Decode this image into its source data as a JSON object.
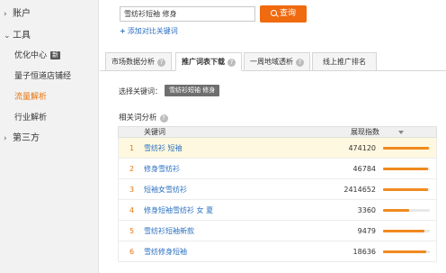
{
  "sidebar": {
    "sections": [
      {
        "label": "账户",
        "chevron": "›",
        "expanded": false
      },
      {
        "label": "工具",
        "chevron": "⌄",
        "expanded": true
      },
      {
        "label": "第三方",
        "chevron": "›",
        "expanded": false
      }
    ],
    "tool_items": [
      {
        "label": "优化中心",
        "badge": "新",
        "active": false
      },
      {
        "label": "量子恒道店铺经",
        "active": false
      },
      {
        "label": "流量解析",
        "active": true
      },
      {
        "label": "行业解析",
        "active": false
      }
    ]
  },
  "search": {
    "value": "雪纺衫短袖 修身",
    "button_label": "查询",
    "add_compare_label": "添加对比关键词"
  },
  "tabs": [
    {
      "label": "市场数据分析",
      "active": false
    },
    {
      "label": "推广词表下载",
      "active": true
    },
    {
      "label": "一周地域透析",
      "active": false
    },
    {
      "label": "线上推广排名",
      "active": false
    }
  ],
  "selected": {
    "label": "选择关键词：",
    "keyword": "雪纺衫短袖 修身"
  },
  "related": {
    "title": "相关词分析",
    "columns": {
      "keyword": "关键词",
      "value": "展现指数"
    },
    "rows": [
      {
        "rank": "1",
        "keyword": "雪纺衫 短袖",
        "value": "474120",
        "bar": 0.98,
        "highlight": true
      },
      {
        "rank": "2",
        "keyword": "修身雪纺衫",
        "value": "46784",
        "bar": 0.96,
        "highlight": false
      },
      {
        "rank": "3",
        "keyword": "短袖女雪纺衫",
        "value": "2414652",
        "bar": 0.97,
        "highlight": false
      },
      {
        "rank": "4",
        "keyword": "修身短袖雪纺衫 女 夏",
        "value": "3360",
        "bar": 0.55,
        "highlight": false
      },
      {
        "rank": "5",
        "keyword": "雪纺衫短袖新款",
        "value": "9479",
        "bar": 0.88,
        "highlight": false
      },
      {
        "rank": "6",
        "keyword": "雪纺修身短袖",
        "value": "18636",
        "bar": 0.92,
        "highlight": false
      }
    ]
  },
  "colors": {
    "accent": "#f06a0f",
    "link": "#2a6fc0",
    "active_nav": "#e8740c",
    "bar": "#f08a1e",
    "highlight_row": "#fdf8df"
  }
}
